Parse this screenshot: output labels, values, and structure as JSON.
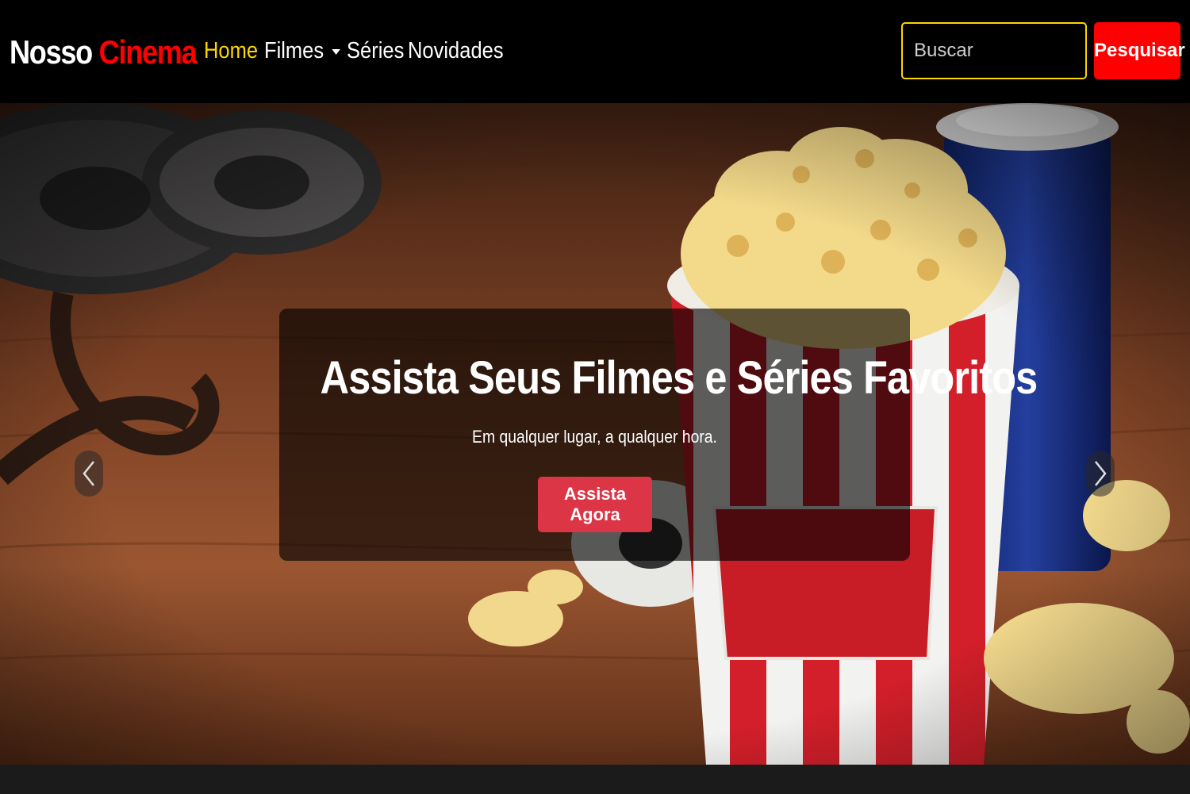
{
  "brand": {
    "word1": "Nosso",
    "word2": "Cinema"
  },
  "nav": {
    "home": "Home",
    "filmes": "Filmes",
    "series": "Séries",
    "novidades": "Novidades"
  },
  "search": {
    "placeholder": "Buscar",
    "button_label": "Pesquisar"
  },
  "hero": {
    "title": "Assista Seus Filmes e Séries Favoritos",
    "subtitle": "Em qualquer lugar, a qualquer hora.",
    "cta_label": "Assista Agora",
    "image_subject": "popcorn-bucket-film-reels-soda"
  },
  "icons": {
    "dropdown": "chevron-down-icon",
    "prev": "chevron-left-icon",
    "next": "chevron-right-icon"
  },
  "colors": {
    "brand_accent": "#ff0000",
    "active_link": "#ffd700",
    "search_border": "#ffd700",
    "cta": "#dc3545",
    "navbar_bg": "#000000"
  }
}
